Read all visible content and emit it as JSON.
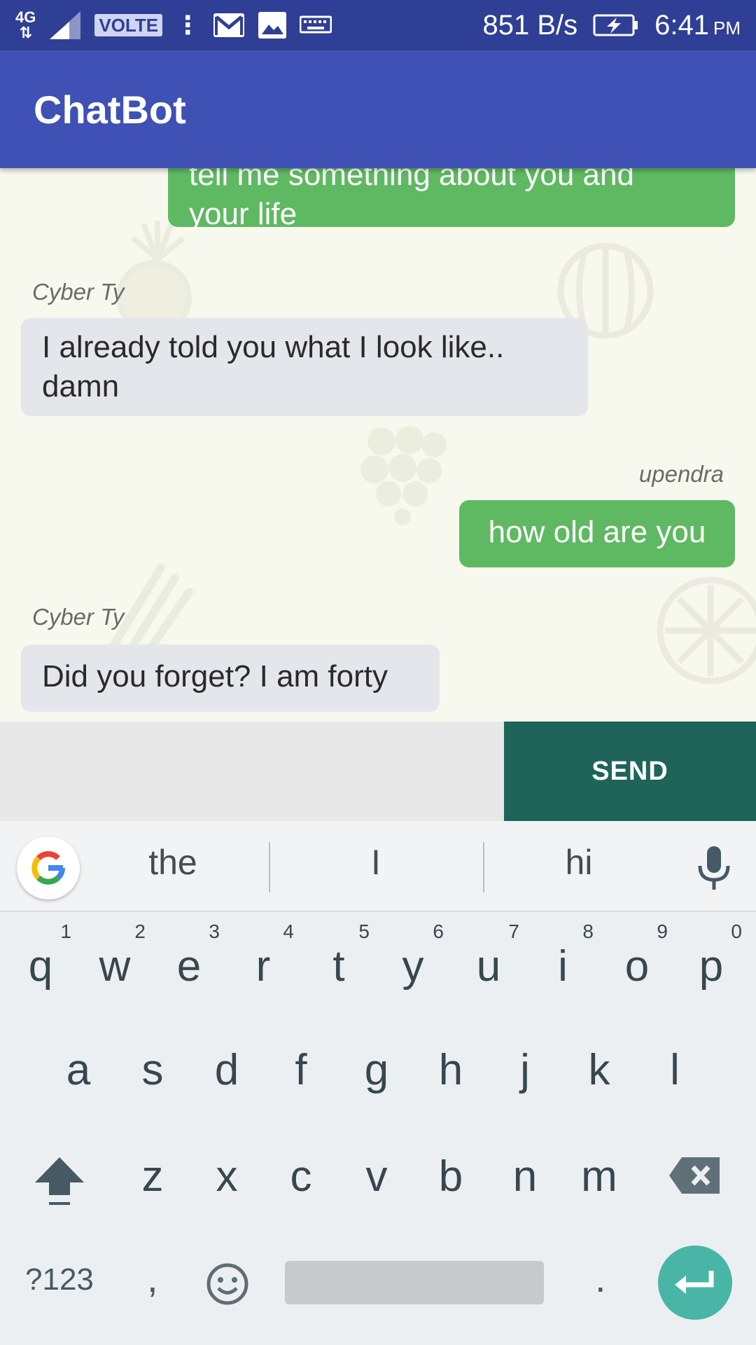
{
  "status_bar": {
    "network": "4G",
    "volte": "VOLTE",
    "speed": "851 B/s",
    "time": "6:41",
    "ampm": "PM"
  },
  "app_bar": {
    "title": "ChatBot"
  },
  "chat": {
    "messages": [
      {
        "from": "user",
        "text_line1": "tell me something about you and",
        "text_line2": "your life"
      },
      {
        "from": "bot",
        "sender": "Cyber Ty",
        "text_line1": "I already told you what I look like..",
        "text_line2": "damn"
      },
      {
        "from": "user",
        "sender": "upendra",
        "text": "how old are you"
      },
      {
        "from": "bot",
        "sender": "Cyber Ty",
        "text": "Did you forget? I am forty"
      }
    ]
  },
  "input": {
    "value": "",
    "send_label": "SEND"
  },
  "keyboard": {
    "suggestions": [
      "the",
      "I",
      "hi"
    ],
    "row1": [
      "q",
      "w",
      "e",
      "r",
      "t",
      "y",
      "u",
      "i",
      "o",
      "p"
    ],
    "row1_hints": [
      "1",
      "2",
      "3",
      "4",
      "5",
      "6",
      "7",
      "8",
      "9",
      "0"
    ],
    "row2": [
      "a",
      "s",
      "d",
      "f",
      "g",
      "h",
      "j",
      "k",
      "l"
    ],
    "row3": [
      "z",
      "x",
      "c",
      "v",
      "b",
      "n",
      "m"
    ],
    "symbols_label": "?123",
    "comma": ",",
    "period": ".",
    "icons": {
      "shift": "shift-icon",
      "backspace": "backspace-icon",
      "emoji": "emoji-icon",
      "enter": "enter-icon",
      "mic": "microphone-icon",
      "google": "google-logo-icon"
    }
  },
  "colors": {
    "status_bar": "#2f3f95",
    "app_bar": "#3f51b5",
    "user_bubble": "#5fb962",
    "bot_bubble": "#e5e6eb",
    "send_button": "#1e6459",
    "enter_key": "#49b5a6"
  }
}
